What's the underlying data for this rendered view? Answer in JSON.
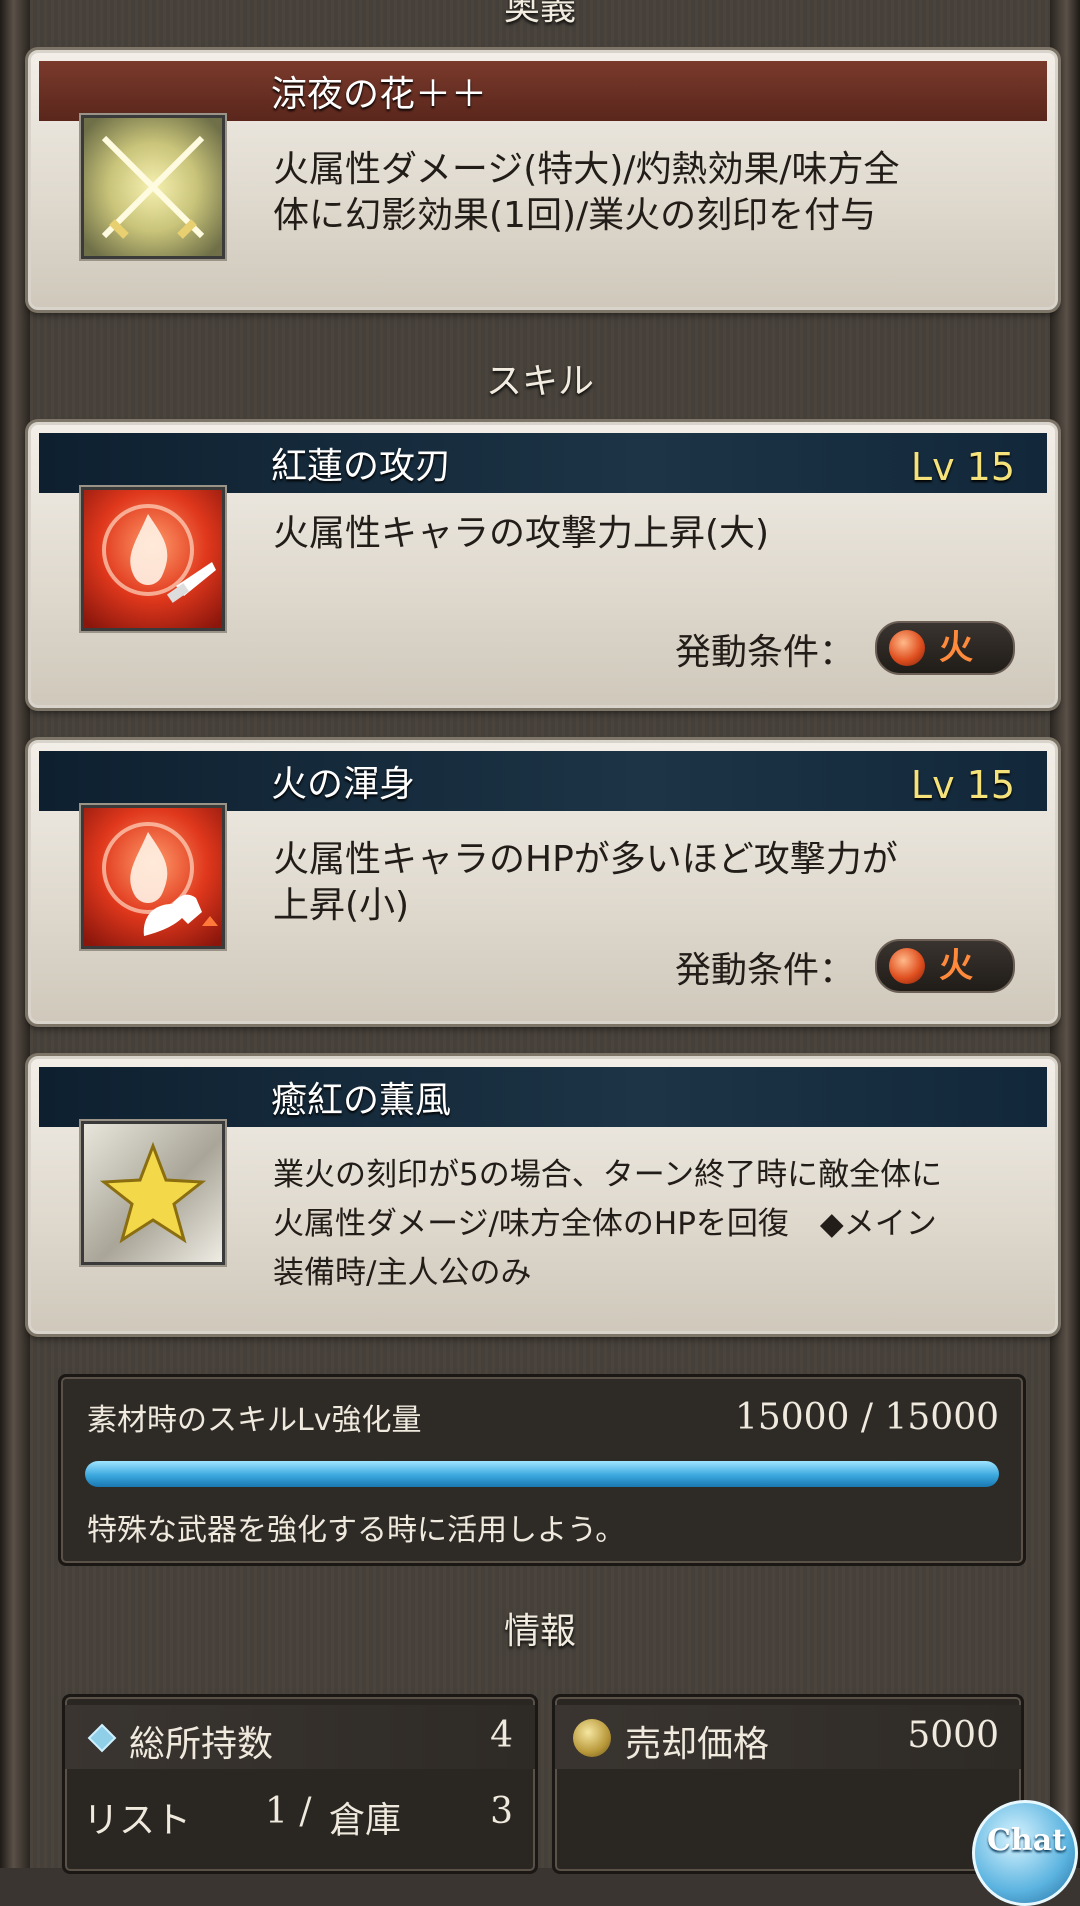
{
  "sections": {
    "ougi": "奥義",
    "skill": "スキル",
    "info": "情報"
  },
  "ougi": {
    "title": "涼夜の花＋＋",
    "desc_line1": "火属性ダメージ(特大)/灼熱効果/味方全",
    "desc_line2": "体に幻影効果(1回)/業火の刻印を付与",
    "icon": "crossed-swords-icon"
  },
  "skills": [
    {
      "title": "紅蓮の攻刃",
      "level": "Lv 15",
      "desc_line1": "火属性キャラの攻撃力上昇(大)",
      "cond_label": "発動条件：",
      "cond_element": "火",
      "icon": "fire-attack-icon"
    },
    {
      "title": "火の渾身",
      "level": "Lv 15",
      "desc_line1": "火属性キャラのHPが多いほど攻撃力が",
      "desc_line2": "上昇(小)",
      "cond_label": "発動条件：",
      "cond_element": "火",
      "icon": "fire-strength-icon"
    },
    {
      "title": "癒紅の薫風",
      "desc_line1": "業火の刻印が5の場合、ターン終了時に敵全体に",
      "desc_line2": "火属性ダメージ/味方全体のHPを回復　◆メイン",
      "desc_line3": "装備時/主人公のみ",
      "icon": "star-icon"
    }
  ],
  "material": {
    "label": "素材時のスキルLv強化量",
    "value": "15000 / 15000",
    "progress": 1.0,
    "hint": "特殊な武器を強化する時に活用しよう。"
  },
  "info": {
    "total_label": "総所持数",
    "total_value": "4",
    "list_label": "リスト",
    "list_value": "1 /",
    "storage_label": "倉庫",
    "storage_value": "3",
    "sell_label": "売却価格",
    "sell_value": "5000"
  },
  "chat": {
    "label": "Chat"
  },
  "colors": {
    "level": "#f5e27a",
    "fire": "#ff8a3c",
    "progress": "#3ba8de"
  }
}
